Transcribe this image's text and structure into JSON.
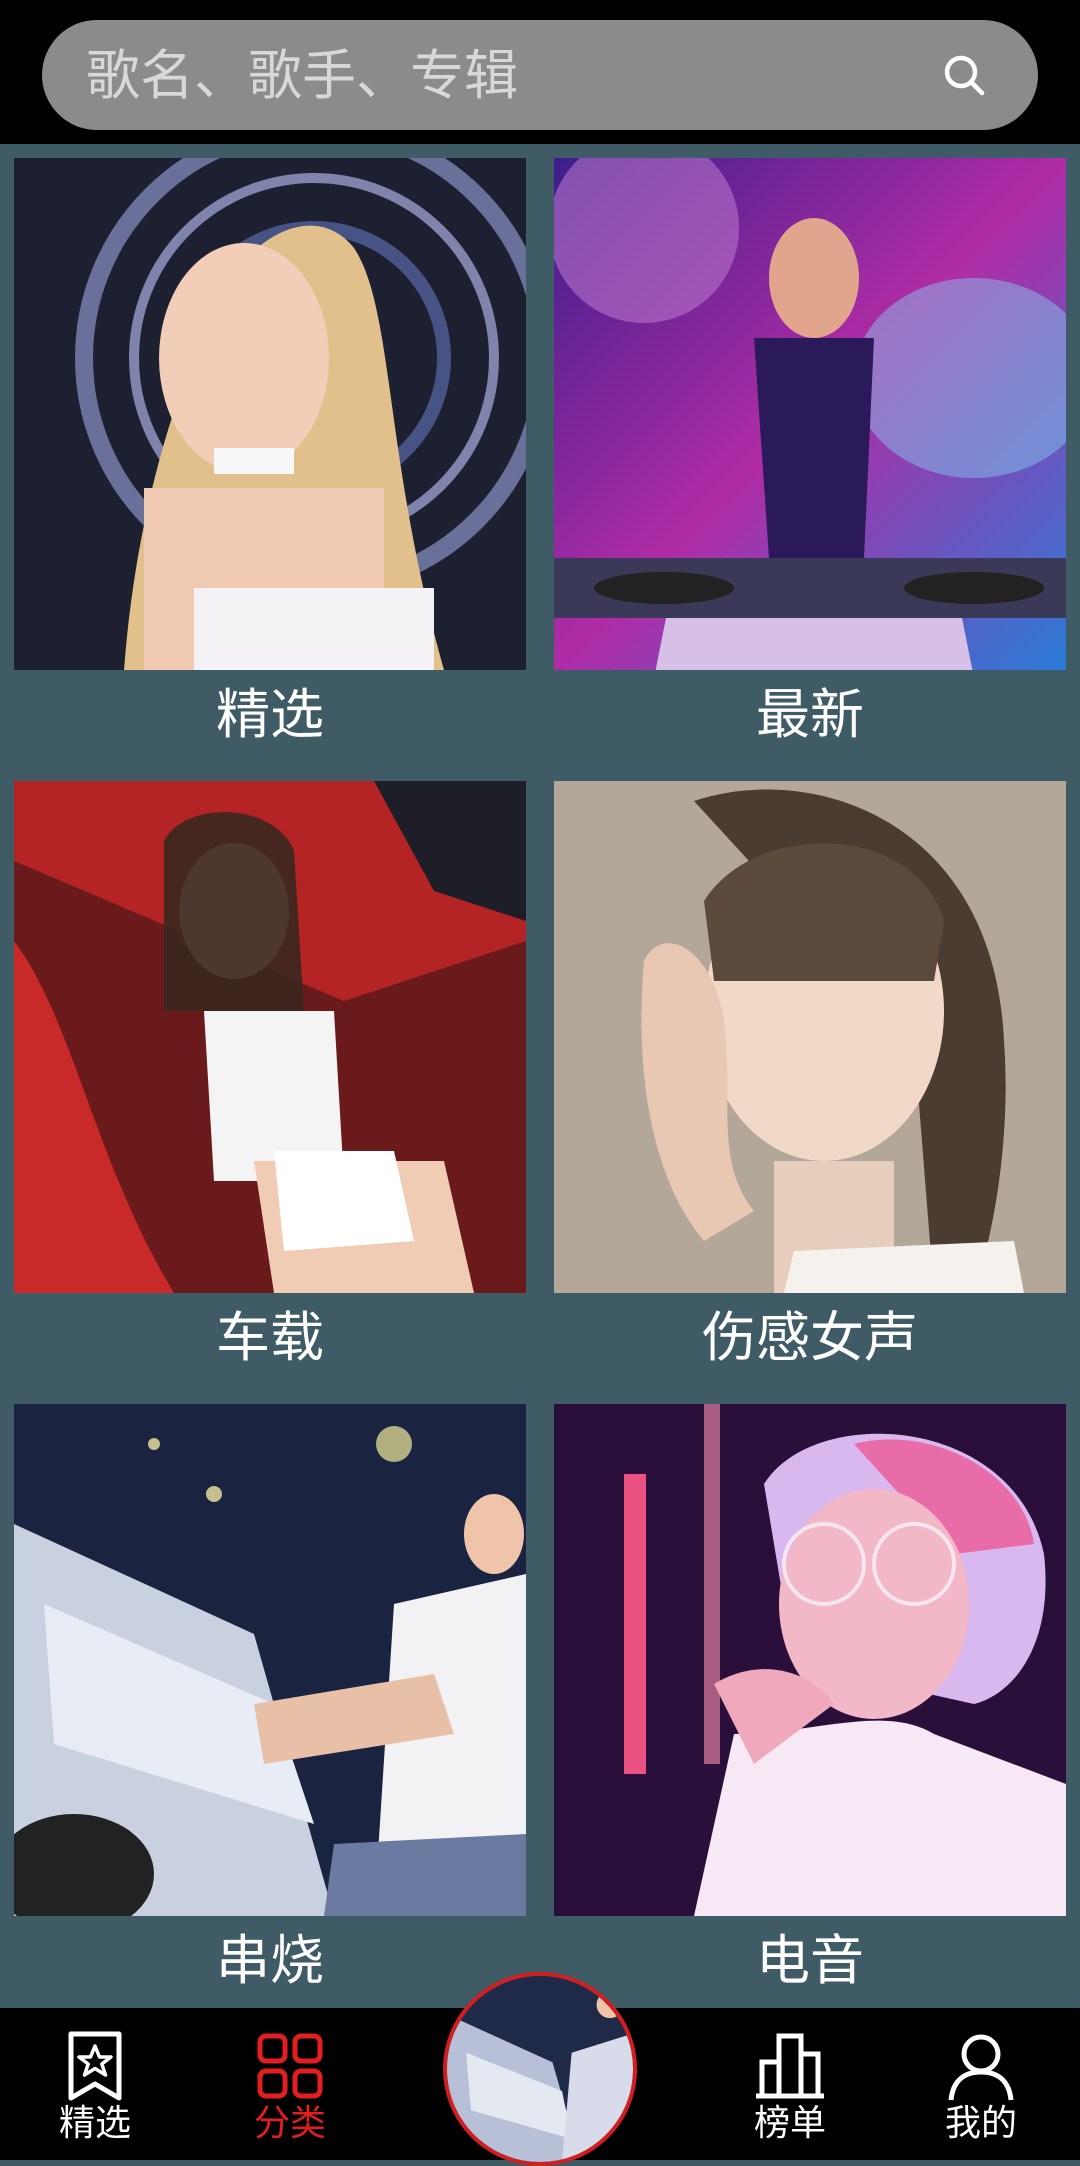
{
  "search": {
    "placeholder": "歌名、歌手、专辑"
  },
  "categories": [
    {
      "label": "精选"
    },
    {
      "label": "最新"
    },
    {
      "label": "车载"
    },
    {
      "label": "伤感女声"
    },
    {
      "label": "串烧"
    },
    {
      "label": "电音"
    }
  ],
  "bottom_nav": [
    {
      "label": "精选",
      "icon": "bookmark-star-icon"
    },
    {
      "label": "分类",
      "icon": "grid-icon"
    },
    {
      "label": "榜单",
      "icon": "bar-chart-icon"
    },
    {
      "label": "我的",
      "icon": "user-icon"
    }
  ],
  "colors": {
    "background": "#3f5b66",
    "bars": "#000000",
    "accent": "#e41e1e",
    "search_bg": "#8b8b8b"
  }
}
